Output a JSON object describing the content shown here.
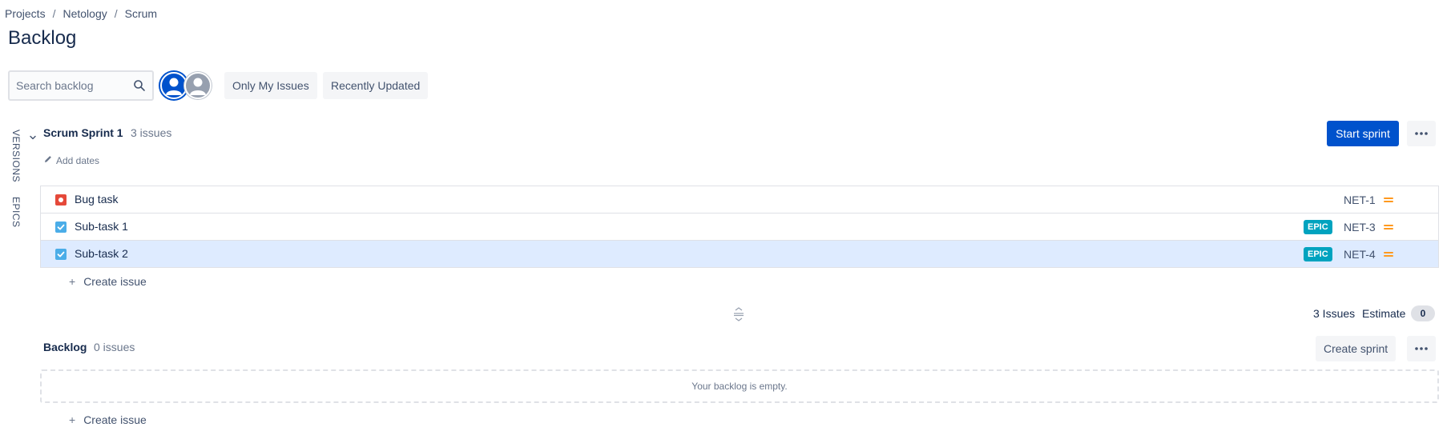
{
  "breadcrumb": [
    {
      "label": "Projects"
    },
    {
      "label": "Netology"
    },
    {
      "label": "Scrum"
    }
  ],
  "breadcrumb_separator": "/",
  "page_title": "Backlog",
  "search": {
    "placeholder": "Search backlog",
    "value": ""
  },
  "filters": {
    "only_my_issues": "Only My Issues",
    "recently_updated": "Recently Updated"
  },
  "side_tabs": {
    "versions": "VERSIONS",
    "epics": "EPICS"
  },
  "sprint": {
    "name": "Scrum Sprint 1",
    "count": "3 issues",
    "add_dates": "Add dates",
    "start_button": "Start sprint",
    "issues": [
      {
        "type": "bug",
        "summary": "Bug task",
        "epic": "",
        "key": "NET-1",
        "priority": "medium"
      },
      {
        "type": "subtask",
        "summary": "Sub-task 1",
        "epic": "EPIC",
        "key": "NET-3",
        "priority": "medium"
      },
      {
        "type": "subtask",
        "summary": "Sub-task 2",
        "epic": "EPIC",
        "key": "NET-4",
        "priority": "medium",
        "selected": true
      }
    ],
    "create_issue": "Create issue",
    "summary_issues": "3 Issues",
    "estimate_label": "Estimate",
    "estimate_value": "0"
  },
  "backlog": {
    "title": "Backlog",
    "count": "0 issues",
    "create_sprint": "Create sprint",
    "empty_text": "Your backlog is empty.",
    "create_issue": "Create issue"
  },
  "colors": {
    "primary": "#0052cc",
    "bug": "#e5493a",
    "subtask": "#4bade8",
    "epic_badge": "#00a3bf",
    "priority_medium": "#ff991f",
    "selected_row": "#deebff"
  }
}
